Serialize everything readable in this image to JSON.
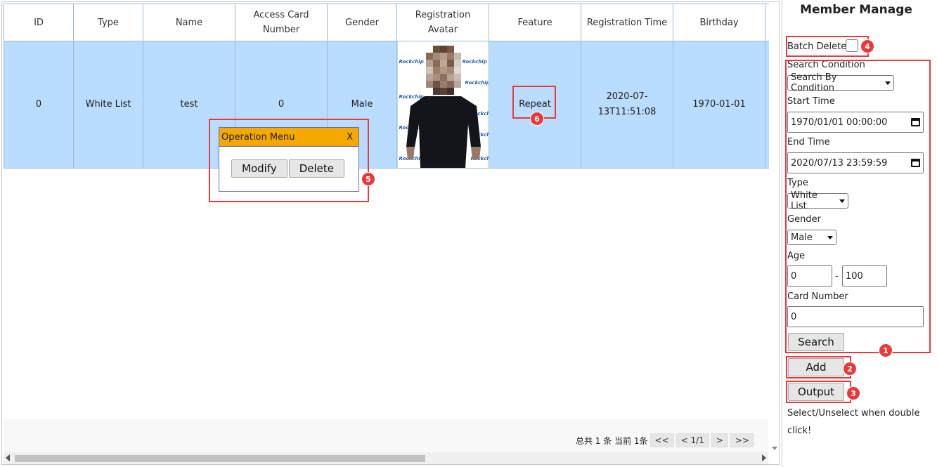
{
  "table": {
    "headers": [
      "ID",
      "Type",
      "Name",
      "Access Card Number",
      "Gender",
      "Registration Avatar",
      "Feature",
      "Registration Time",
      "Birthday"
    ],
    "row": {
      "id": "0",
      "type": "White List",
      "name": "test",
      "card": "0",
      "gender": "Male",
      "feature": "Repeat",
      "reg_time": "2020-07-13T11:51:08",
      "birthday": "1970-01-01"
    },
    "avatar_logo": "Rockchip"
  },
  "op_menu": {
    "title": "Operation Menu",
    "close": "X",
    "modify": "Modify",
    "delete": "Delete"
  },
  "pager": {
    "total": "总共 1 条 当前 1条",
    "first": "<<",
    "prev": "<",
    "page": "1/1",
    "next": ">",
    "last": ">>"
  },
  "sidebar": {
    "title": "Member Manage",
    "batch_delete": "Batch Delete",
    "search_condition_label": "Search Condition",
    "search_condition_value": "Search By Condition",
    "start_time_label": "Start Time",
    "start_time_value": "1970/01/01 00:00:00",
    "end_time_label": "End Time",
    "end_time_value": "2020/07/13 23:59:59",
    "type_label": "Type",
    "type_value": "White List",
    "gender_label": "Gender",
    "gender_value": "Male",
    "age_label": "Age",
    "age_min": "0",
    "age_sep": "-",
    "age_max": "100",
    "card_label": "Card Number",
    "card_value": "0",
    "search_btn": "Search",
    "add_btn": "Add",
    "output_btn": "Output",
    "note": "Select/Unselect when double click!"
  },
  "badges": [
    "1",
    "2",
    "3",
    "4",
    "5",
    "6"
  ],
  "colors": {
    "row_selected": "#b9dcff",
    "menu_title": "#f5a800",
    "annotation": "#e8393c"
  }
}
